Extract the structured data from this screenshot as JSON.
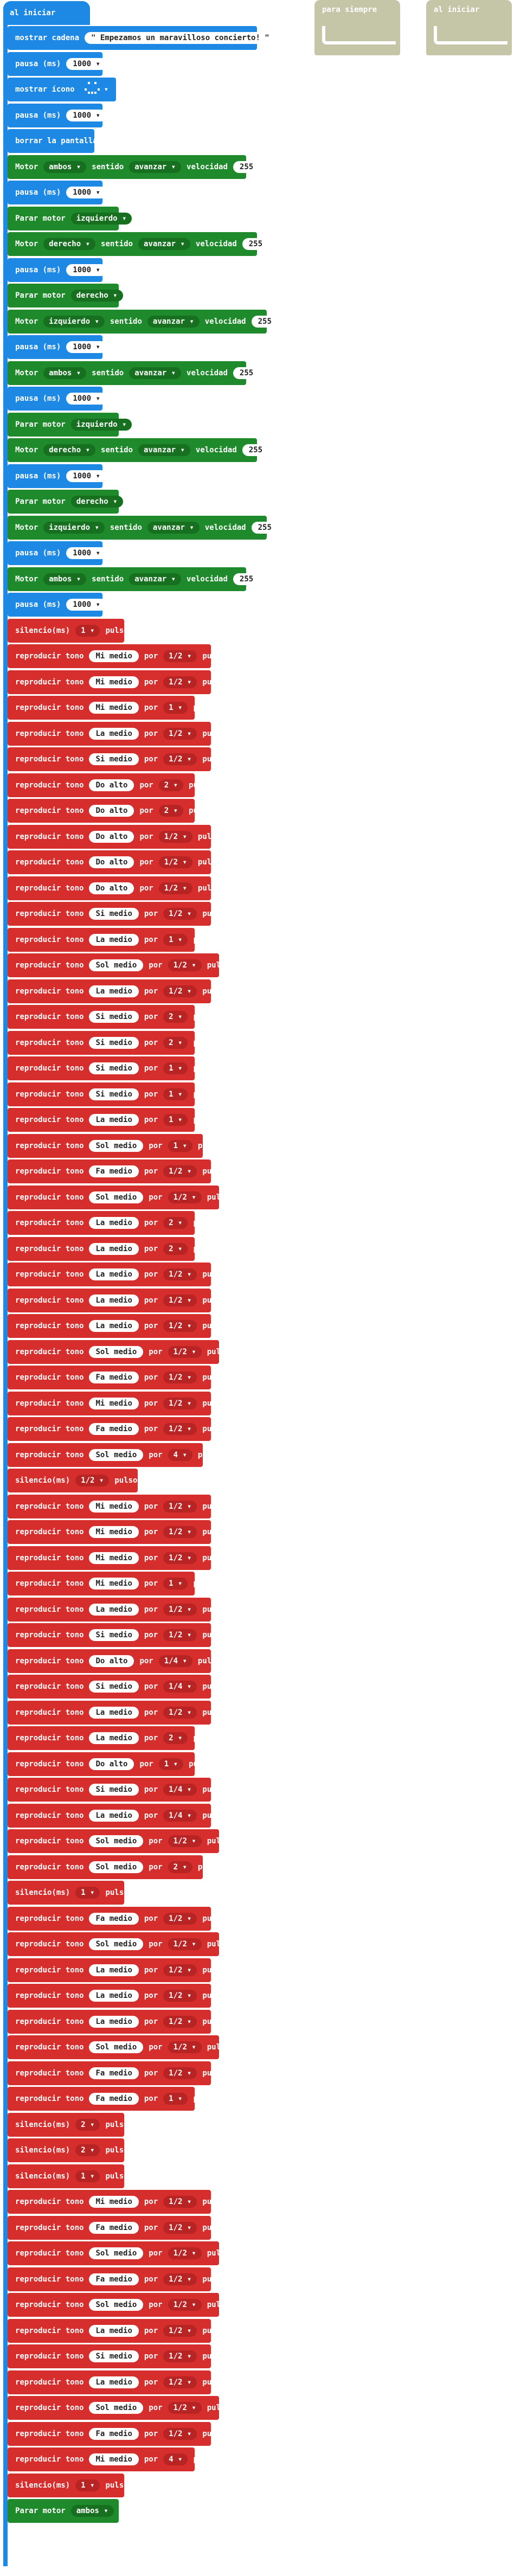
{
  "on_start_label": "al iniciar",
  "forever_label": "para siempre",
  "on_start_label_2": "al iniciar",
  "colors": {
    "basic": "#1e88e5",
    "motor": "#1e8a2b",
    "music": "#d62d2d",
    "event": "#c5c5a8"
  },
  "blocks": [
    {
      "t": "basic",
      "w": [
        "mostrar cadena"
      ],
      "pill": "\" Empezamos un maravilloso concierto! \""
    },
    {
      "t": "basic",
      "w": [
        "pausa (ms)"
      ],
      "pill": "1000",
      "dd": "▾"
    },
    {
      "t": "basic",
      "w": [
        "mostrar ícono"
      ],
      "icon": "happy-face-icon"
    },
    {
      "t": "basic",
      "w": [
        "pausa (ms)"
      ],
      "pill": "1000",
      "dd": "▾"
    },
    {
      "t": "basic",
      "w": [
        "borrar la pantalla"
      ]
    },
    {
      "t": "motor",
      "w": [
        "Motor",
        "ambos",
        "sentido",
        "avanzar",
        "velocidad"
      ],
      "pill": "255"
    },
    {
      "t": "basic",
      "w": [
        "pausa (ms)"
      ],
      "pill": "1000",
      "dd": "▾"
    },
    {
      "t": "motor",
      "w": [
        "Parar motor",
        "izquierdo"
      ]
    },
    {
      "t": "motor",
      "w": [
        "Motor",
        "derecho",
        "sentido",
        "avanzar",
        "velocidad"
      ],
      "pill": "255"
    },
    {
      "t": "basic",
      "w": [
        "pausa (ms)"
      ],
      "pill": "1000",
      "dd": "▾"
    },
    {
      "t": "motor",
      "w": [
        "Parar motor",
        "derecho"
      ]
    },
    {
      "t": "motor",
      "w": [
        "Motor",
        "izquierdo",
        "sentido",
        "avanzar",
        "velocidad"
      ],
      "pill": "255"
    },
    {
      "t": "basic",
      "w": [
        "pausa (ms)"
      ],
      "pill": "1000",
      "dd": "▾"
    },
    {
      "t": "motor",
      "w": [
        "Motor",
        "ambos",
        "sentido",
        "avanzar",
        "velocidad"
      ],
      "pill": "255"
    },
    {
      "t": "basic",
      "w": [
        "pausa (ms)"
      ],
      "pill": "1000",
      "dd": "▾"
    },
    {
      "t": "motor",
      "w": [
        "Parar motor",
        "izquierdo"
      ]
    },
    {
      "t": "motor",
      "w": [
        "Motor",
        "derecho",
        "sentido",
        "avanzar",
        "velocidad"
      ],
      "pill": "255"
    },
    {
      "t": "basic",
      "w": [
        "pausa (ms)"
      ],
      "pill": "1000",
      "dd": "▾"
    },
    {
      "t": "motor",
      "w": [
        "Parar motor",
        "derecho"
      ]
    },
    {
      "t": "motor",
      "w": [
        "Motor",
        "izquierdo",
        "sentido",
        "avanzar",
        "velocidad"
      ],
      "pill": "255"
    },
    {
      "t": "basic",
      "w": [
        "pausa (ms)"
      ],
      "pill": "1000",
      "dd": "▾"
    },
    {
      "t": "motor",
      "w": [
        "Motor",
        "ambos",
        "sentido",
        "avanzar",
        "velocidad"
      ],
      "pill": "255"
    },
    {
      "t": "basic",
      "w": [
        "pausa (ms)"
      ],
      "pill": "1000",
      "dd": "▾"
    },
    {
      "t": "silence",
      "val": "1"
    },
    {
      "t": "tone",
      "note": "Mi medio",
      "dur": "1/2"
    },
    {
      "t": "tone",
      "note": "Mi medio",
      "dur": "1/2"
    },
    {
      "t": "tone",
      "note": "Mi medio",
      "dur": "1"
    },
    {
      "t": "tone",
      "note": "La medio",
      "dur": "1/2"
    },
    {
      "t": "tone",
      "note": "Si medio",
      "dur": "1/2"
    },
    {
      "t": "tone",
      "note": "Do alto",
      "dur": "2"
    },
    {
      "t": "tone",
      "note": "Do alto",
      "dur": "2"
    },
    {
      "t": "tone",
      "note": "Do alto",
      "dur": "1/2"
    },
    {
      "t": "tone",
      "note": "Do alto",
      "dur": "1/2"
    },
    {
      "t": "tone",
      "note": "Do alto",
      "dur": "1/2"
    },
    {
      "t": "tone",
      "note": "Si medio",
      "dur": "1/2"
    },
    {
      "t": "tone",
      "note": "La medio",
      "dur": "1"
    },
    {
      "t": "tone",
      "note": "Sol medio",
      "dur": "1/2"
    },
    {
      "t": "tone",
      "note": "La medio",
      "dur": "1/2"
    },
    {
      "t": "tone",
      "note": "Si medio",
      "dur": "2"
    },
    {
      "t": "tone",
      "note": "Si medio",
      "dur": "2"
    },
    {
      "t": "tone",
      "note": "Si medio",
      "dur": "1"
    },
    {
      "t": "tone",
      "note": "Si medio",
      "dur": "1"
    },
    {
      "t": "tone",
      "note": "La medio",
      "dur": "1"
    },
    {
      "t": "tone",
      "note": "Sol medio",
      "dur": "1"
    },
    {
      "t": "tone",
      "note": "Fa medio",
      "dur": "1/2"
    },
    {
      "t": "tone",
      "note": "Sol medio",
      "dur": "1/2"
    },
    {
      "t": "tone",
      "note": "La medio",
      "dur": "2"
    },
    {
      "t": "tone",
      "note": "La medio",
      "dur": "2"
    },
    {
      "t": "tone",
      "note": "La medio",
      "dur": "1/2"
    },
    {
      "t": "tone",
      "note": "La medio",
      "dur": "1/2"
    },
    {
      "t": "tone",
      "note": "La medio",
      "dur": "1/2"
    },
    {
      "t": "tone",
      "note": "Sol medio",
      "dur": "1/2"
    },
    {
      "t": "tone",
      "note": "Fa medio",
      "dur": "1/2"
    },
    {
      "t": "tone",
      "note": "Mi medio",
      "dur": "1/2"
    },
    {
      "t": "tone",
      "note": "Fa medio",
      "dur": "1/2"
    },
    {
      "t": "tone",
      "note": "Sol medio",
      "dur": "4"
    },
    {
      "t": "silence",
      "val": "1/2"
    },
    {
      "t": "tone",
      "note": "Mi medio",
      "dur": "1/2"
    },
    {
      "t": "tone",
      "note": "Mi medio",
      "dur": "1/2"
    },
    {
      "t": "tone",
      "note": "Mi medio",
      "dur": "1/2"
    },
    {
      "t": "tone",
      "note": "Mi medio",
      "dur": "1"
    },
    {
      "t": "tone",
      "note": "La medio",
      "dur": "1/2"
    },
    {
      "t": "tone",
      "note": "Si medio",
      "dur": "1/2"
    },
    {
      "t": "tone",
      "note": "Do alto",
      "dur": "1/4"
    },
    {
      "t": "tone",
      "note": "Si medio",
      "dur": "1/4"
    },
    {
      "t": "tone",
      "note": "La medio",
      "dur": "1/2"
    },
    {
      "t": "tone",
      "note": "La medio",
      "dur": "2"
    },
    {
      "t": "tone",
      "note": "Do alto",
      "dur": "1"
    },
    {
      "t": "tone",
      "note": "Si medio",
      "dur": "1/4"
    },
    {
      "t": "tone",
      "note": "La medio",
      "dur": "1/4"
    },
    {
      "t": "tone",
      "note": "Sol medio",
      "dur": "1/2"
    },
    {
      "t": "tone",
      "note": "Sol medio",
      "dur": "2"
    },
    {
      "t": "silence",
      "val": "1"
    },
    {
      "t": "tone",
      "note": "Fa medio",
      "dur": "1/2"
    },
    {
      "t": "tone",
      "note": "Sol medio",
      "dur": "1/2"
    },
    {
      "t": "tone",
      "note": "La medio",
      "dur": "1/2"
    },
    {
      "t": "tone",
      "note": "La medio",
      "dur": "1/2"
    },
    {
      "t": "tone",
      "note": "La medio",
      "dur": "1/2"
    },
    {
      "t": "tone",
      "note": "Sol medio",
      "dur": "1/2"
    },
    {
      "t": "tone",
      "note": "Fa medio",
      "dur": "1/2"
    },
    {
      "t": "tone",
      "note": "Fa medio",
      "dur": "1"
    },
    {
      "t": "silence",
      "val": "2"
    },
    {
      "t": "silence",
      "val": "2"
    },
    {
      "t": "silence",
      "val": "1"
    },
    {
      "t": "tone",
      "note": "Mi medio",
      "dur": "1/2"
    },
    {
      "t": "tone",
      "note": "Fa medio",
      "dur": "1/2"
    },
    {
      "t": "tone",
      "note": "Sol medio",
      "dur": "1/2"
    },
    {
      "t": "tone",
      "note": "Fa medio",
      "dur": "1/2"
    },
    {
      "t": "tone",
      "note": "Sol medio",
      "dur": "1/2"
    },
    {
      "t": "tone",
      "note": "La medio",
      "dur": "1/2"
    },
    {
      "t": "tone",
      "note": "Si medio",
      "dur": "1/2"
    },
    {
      "t": "tone",
      "note": "La medio",
      "dur": "1/2"
    },
    {
      "t": "tone",
      "note": "Sol medio",
      "dur": "1/2"
    },
    {
      "t": "tone",
      "note": "Fa medio",
      "dur": "1/2"
    },
    {
      "t": "tone",
      "note": "Mi medio",
      "dur": "4"
    },
    {
      "t": "silence",
      "val": "1"
    },
    {
      "t": "motor",
      "w": [
        "Parar motor",
        "ambos"
      ]
    }
  ],
  "labels": {
    "tone_prefix": "reproducir tono",
    "by": "por",
    "beat": "pulso",
    "silence": "silencio(ms)"
  }
}
